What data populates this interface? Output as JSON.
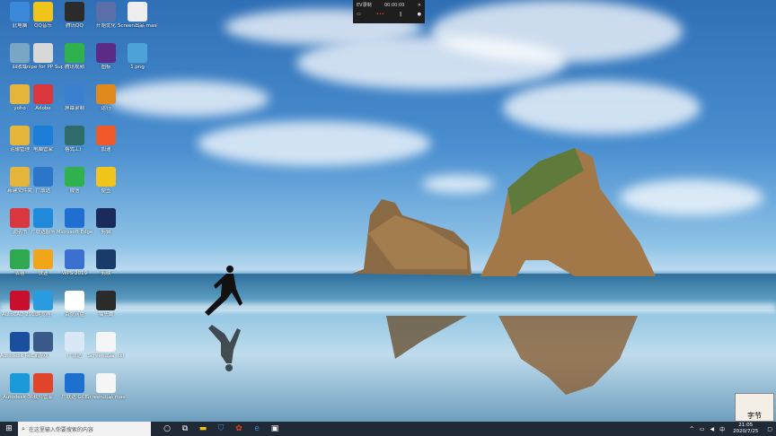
{
  "desktop_icons": [
    {
      "label": "此电脑",
      "color": "#3b8ad9",
      "icon": "computer-icon"
    },
    {
      "label": "QQ音乐",
      "color": "#f0c41b",
      "icon": "qq-music-icon"
    },
    {
      "label": "腾讯QQ",
      "color": "#2b2b2b",
      "icon": "qq-icon"
    },
    {
      "label": "开始优化",
      "color": "#5a6fa8",
      "icon": "optimizer-icon"
    },
    {
      "label": "Screen出品 masked fi...",
      "color": "#eeeeee",
      "icon": "file-icon"
    },
    {
      "label": "回收站",
      "color": "#7aa6c6",
      "icon": "recycle-bin-icon"
    },
    {
      "label": "Snipe for PP Supplier",
      "color": "#d8d8d8",
      "icon": "printer-icon"
    },
    {
      "label": "腾讯视频",
      "color": "#2fb24e",
      "icon": "video-icon"
    },
    {
      "label": "图标",
      "color": "#5b2b86",
      "icon": "app-m-icon"
    },
    {
      "label": "1.png",
      "color": "#4da3d8",
      "icon": "image-file-icon"
    },
    {
      "label": "yoho",
      "color": "#e5b43b",
      "icon": "folder-icon"
    },
    {
      "label": "Adobe",
      "color": "#d9363e",
      "icon": "adobe-icon"
    },
    {
      "label": "屏幕录制",
      "color": "#3b7fd0",
      "icon": "recorder-icon"
    },
    {
      "label": "运行",
      "color": "#e08a1e",
      "icon": "overwatch-icon"
    },
    {
      "label": "运输管理",
      "color": "#e5b43b",
      "icon": "folder-icon"
    },
    {
      "label": "电脑管家",
      "color": "#1c7ed6",
      "icon": "shield-icon"
    },
    {
      "label": "格式工厂",
      "color": "#2f6b6b",
      "icon": "format-icon"
    },
    {
      "label": "加速",
      "color": "#f05a2b",
      "icon": "accelerator-icon"
    },
    {
      "label": "新建文件夹",
      "color": "#e5b43b",
      "icon": "folder-icon"
    },
    {
      "label": "广联达",
      "color": "#2b76c8",
      "icon": "glodon-icon"
    },
    {
      "label": "微信",
      "color": "#2fb24e",
      "icon": "wechat-icon"
    },
    {
      "label": "便签",
      "color": "#f0c41b",
      "icon": "notes-icon"
    },
    {
      "label": "说明书",
      "color": "#d9363e",
      "icon": "pdf-icon"
    },
    {
      "label": "广联达服务",
      "color": "#1f8ad9",
      "icon": "service-icon"
    },
    {
      "label": "Microsoft Edge",
      "color": "#1f6fd0",
      "icon": "edge-icon"
    },
    {
      "label": "剪辑",
      "color": "#1a2a5a",
      "icon": "editor-icon"
    },
    {
      "label": "表格",
      "color": "#2fa84f",
      "icon": "sheet-icon"
    },
    {
      "label": "快递",
      "color": "#f0a51b",
      "icon": "express-icon"
    },
    {
      "label": "WPS 2019",
      "color": "#3b6fd0",
      "icon": "wps-icon"
    },
    {
      "label": "剪映",
      "color": "#1a3b6a",
      "icon": "capcut-icon"
    },
    {
      "label": "AutoCAD 2010",
      "color": "#c8102e",
      "icon": "autocad-icon"
    },
    {
      "label": "浏览器",
      "color": "#2b9be0",
      "icon": "browser-icon"
    },
    {
      "label": "百度网盘",
      "color": "#ffffff",
      "icon": "netdisk-icon"
    },
    {
      "label": "猫头鹰",
      "color": "#2b2b2b",
      "icon": "owl-icon"
    },
    {
      "label": "Autodesk ReCap",
      "color": "#1a4fa0",
      "icon": "recap-icon"
    },
    {
      "label": "游戏",
      "color": "#3b5a8a",
      "icon": "game-icon"
    },
    {
      "label": "广联达",
      "color": "#d8e8f5",
      "icon": "glodon2-icon"
    },
    {
      "label": "Screen出品 .txt",
      "color": "#f5f5f5",
      "icon": "text-file-icon"
    },
    {
      "label": "Autodesk 360",
      "color": "#1a9ad9",
      "icon": "autodesk-icon"
    },
    {
      "label": "软件管家",
      "color": "#e0442b",
      "icon": "software-icon"
    },
    {
      "label": "广联达 GCL",
      "color": "#1f6fd0",
      "icon": "gcl-icon"
    },
    {
      "label": "Screen出品 masked fi...",
      "color": "#f5f5f5",
      "icon": "file-icon"
    }
  ],
  "recorder": {
    "title": "EV录制",
    "time": "00:00:00"
  },
  "taskbar": {
    "search_placeholder": "在这里输入你要搜索的内容",
    "time": "21:05",
    "date": "2020/7/25"
  },
  "widget": {
    "label": "字节"
  }
}
